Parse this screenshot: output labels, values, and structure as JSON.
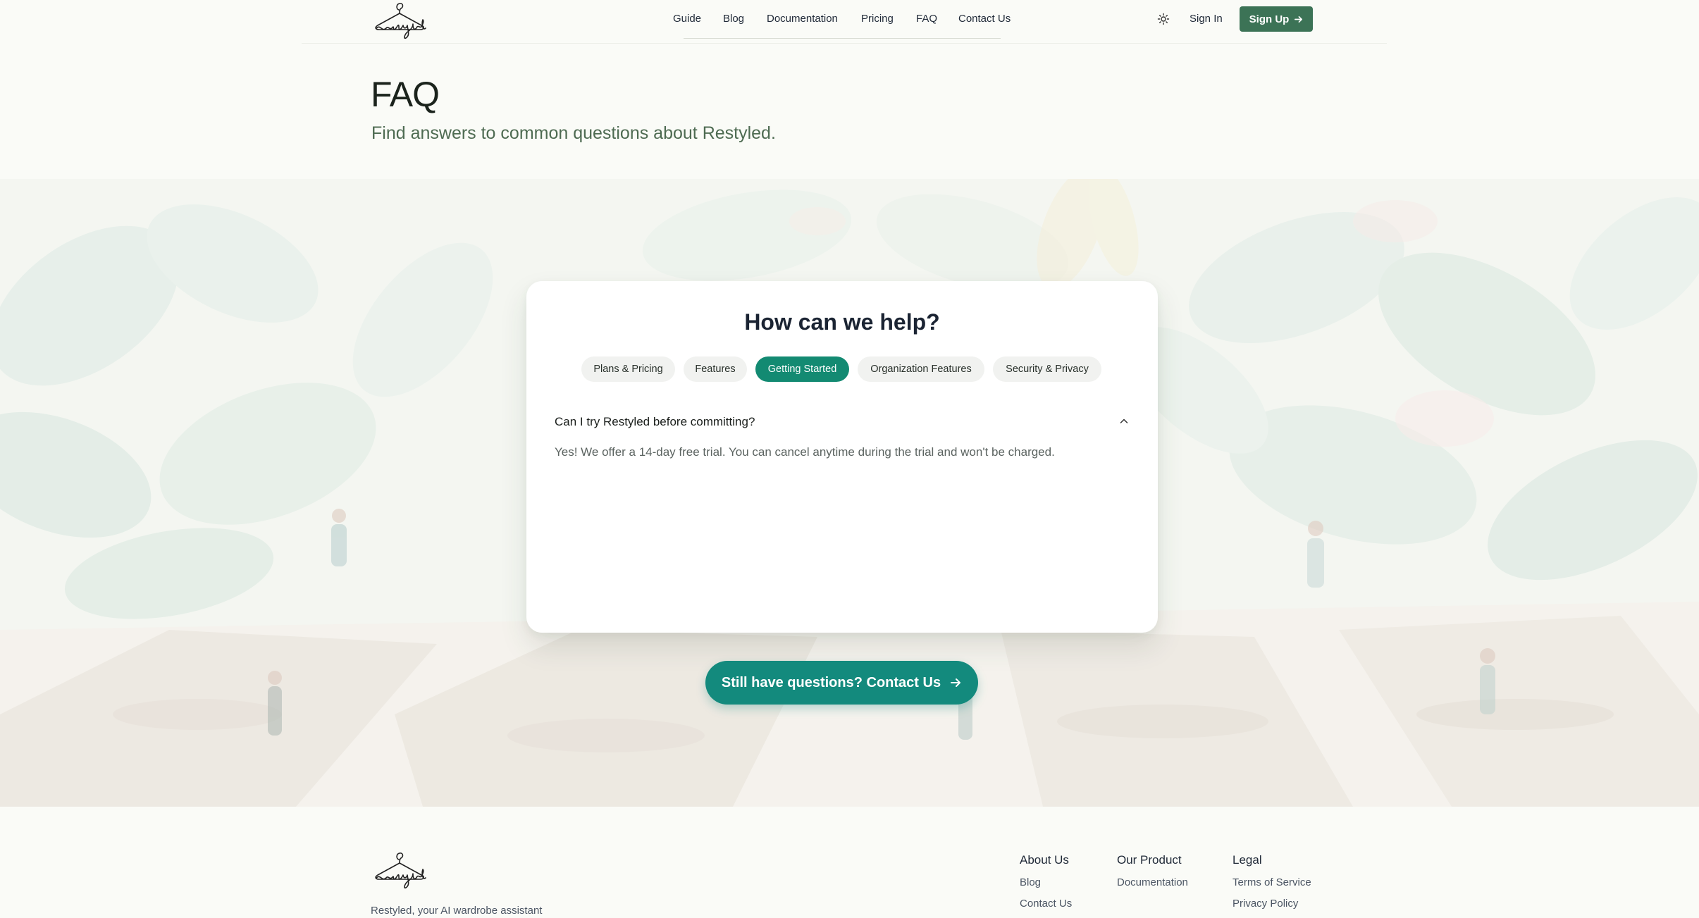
{
  "nav": {
    "logo_alt": "restyled",
    "links": [
      {
        "label": "Guide"
      },
      {
        "label": "Blog"
      },
      {
        "label": "Documentation"
      },
      {
        "label": "Pricing"
      },
      {
        "label": "FAQ"
      },
      {
        "label": "Contact Us"
      }
    ],
    "theme_icon": "sun-icon",
    "sign_in": "Sign In",
    "sign_up": "Sign Up",
    "sign_up_icon": "arrow-right-icon"
  },
  "hero": {
    "title": "FAQ",
    "subtitle": "Find answers to common questions about Restyled."
  },
  "faq": {
    "heading": "How can we help?",
    "tabs": [
      {
        "label": "Plans & Pricing",
        "active": false
      },
      {
        "label": "Features",
        "active": false
      },
      {
        "label": "Getting Started",
        "active": true
      },
      {
        "label": "Organization Features",
        "active": false
      },
      {
        "label": "Security & Privacy",
        "active": false
      }
    ],
    "items": [
      {
        "question": "Can I try Restyled before committing?",
        "answer": "Yes! We offer a 14-day free trial. You can cancel anytime during the trial and won't be charged.",
        "expanded": true,
        "icon": "chevron-up-icon"
      }
    ]
  },
  "cta": {
    "label": "Still have questions? Contact Us",
    "icon": "arrow-right-icon"
  },
  "footer": {
    "tagline": "Restyled, your AI wardrobe assistant",
    "columns": [
      {
        "heading": "About Us",
        "links": [
          "Blog",
          "Contact Us"
        ]
      },
      {
        "heading": "Our Product",
        "links": [
          "Documentation"
        ]
      },
      {
        "heading": "Legal",
        "links": [
          "Terms of Service",
          "Privacy Policy"
        ]
      }
    ]
  },
  "colors": {
    "page_bg": "#fafbf7",
    "brand_green": "#3c7356",
    "accent_teal": "#138a72",
    "cta_teal": "#138a7d"
  }
}
